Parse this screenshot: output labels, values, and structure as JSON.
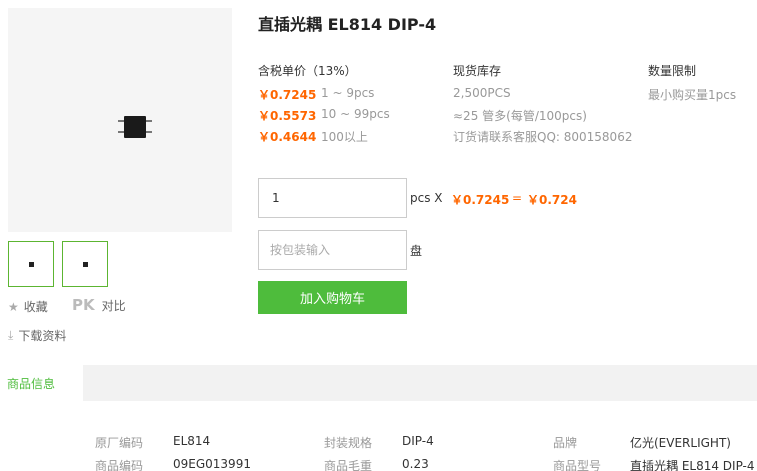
{
  "product": {
    "title": "直插光耦 EL814 DIP-4"
  },
  "actions": {
    "favorite": "收藏",
    "pk_icon": "PK",
    "compare": "对比",
    "download": "下载资料"
  },
  "pricing": {
    "header": "含税单价（13%）",
    "tiers": [
      {
        "price": "￥0.7245",
        "qty": "1 ~ 9pcs"
      },
      {
        "price": "￥0.5573",
        "qty": "10 ~ 99pcs"
      },
      {
        "price": "￥0.4644",
        "qty": "100以上"
      }
    ]
  },
  "stock": {
    "header": "现货库存",
    "lines": [
      "2,500PCS",
      "≈25 管多(每管/100pcs)",
      "订货请联系客服QQ: 800158062"
    ]
  },
  "limit": {
    "header": "数量限制",
    "text": "最小购买量1pcs"
  },
  "order": {
    "qty_value": "1",
    "qty_unit": "pcs X",
    "unit_price": "￥0.7245",
    "equals": "=",
    "total": "￥0.724",
    "pack_placeholder": "按包装输入",
    "pack_unit": "盘",
    "cart_button": "加入购物车"
  },
  "tabs": {
    "active": "商品信息"
  },
  "specs": {
    "row1": [
      {
        "label": "原厂编码",
        "value": "EL814"
      },
      {
        "label": "封装规格",
        "value": "DIP-4"
      },
      {
        "label": "品牌",
        "value": "亿光(EVERLIGHT)"
      }
    ],
    "row2": [
      {
        "label": "商品编码",
        "value": "09EG013991"
      },
      {
        "label": "商品毛重",
        "value": "0.23"
      },
      {
        "label": "商品型号",
        "value": "直插光耦 EL814 DIP-4"
      }
    ]
  },
  "colors": {
    "accent_green": "#4ebc3c",
    "price_orange": "#ff6600"
  }
}
